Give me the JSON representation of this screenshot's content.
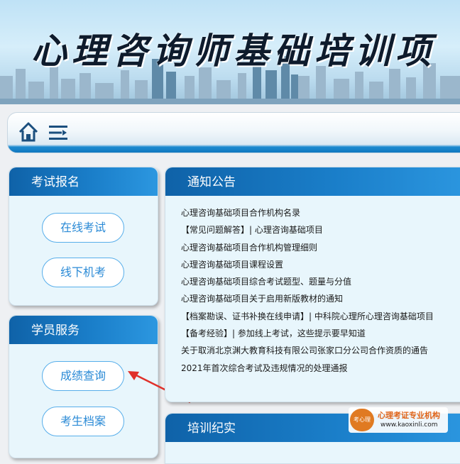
{
  "banner": {
    "title": "心理咨询师基础培训项"
  },
  "toolbar": {
    "home_icon": "home-icon",
    "menu_icon": "menu-icon"
  },
  "sidebar": {
    "exam": {
      "title": "考试报名",
      "buttons": [
        "在线考试",
        "线下机考"
      ]
    },
    "student": {
      "title": "学员服务",
      "buttons": [
        "成绩查询",
        "考生档案"
      ]
    }
  },
  "notice": {
    "title": "通知公告",
    "items": [
      "心理咨询基础项目合作机构名录",
      "【常见问题解答】| 心理咨询基础项目",
      "心理咨询基础项目合作机构管理细则",
      "心理咨询基础项目课程设置",
      "心理咨询基础项目综合考试题型、题量与分值",
      "心理咨询基础项目关于启用新版教材的通知",
      "【档案勘误、证书补换在线申请】|  中科院心理所心理咨询基础项目",
      "【备考经验】| 参加线上考试，这些提示要早知道",
      "关于取消北京渊大教育科技有限公司张家口分公司合作资质的通告",
      "2021年首次综合考试及违规情况的处理通报"
    ]
  },
  "training": {
    "title": "培训纪实"
  },
  "watermark": {
    "seal": "考心理",
    "title": "心理考证专业机构",
    "url": "www.kaoxinli.com"
  },
  "colors": {
    "accent": "#1a7ec9",
    "pill_border": "#57aeea",
    "arrow": "#e0302a"
  }
}
